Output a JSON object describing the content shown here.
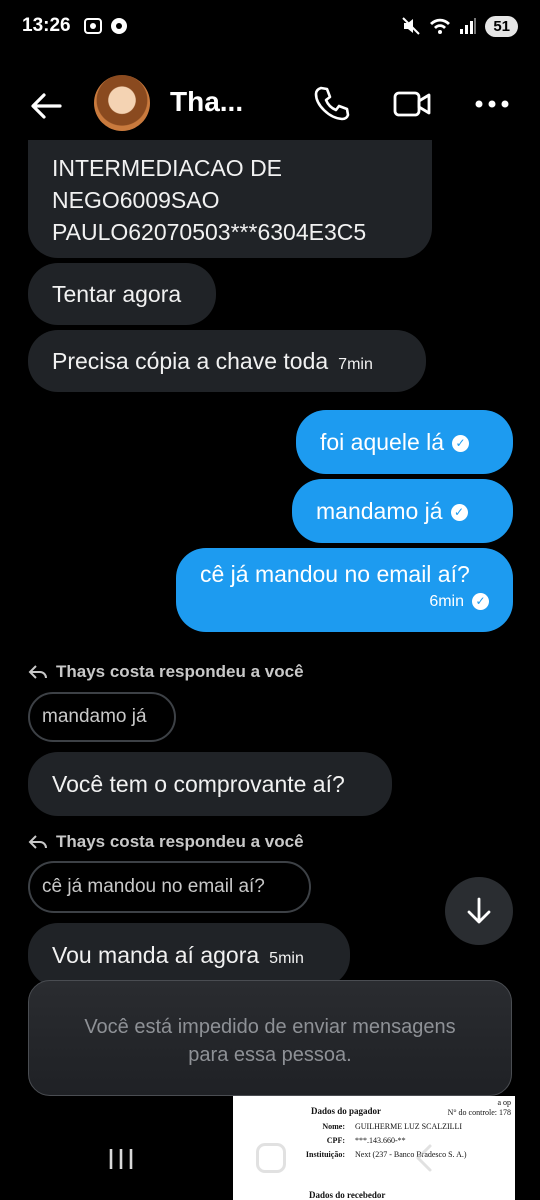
{
  "status_bar": {
    "time": "13:26",
    "battery": "51"
  },
  "header": {
    "contact_name": "Tha..."
  },
  "messages": {
    "m1_line1": "INTERMEDIACAO DE",
    "m1_line2": "NEGO6009SAO",
    "m1_line3": "PAULO62070503***6304E3C5",
    "m2": "Tentar agora",
    "m3": "Precisa cópia a chave toda",
    "m3_time": "7min",
    "m4": "foi aquele lá",
    "m5": "mandamo já",
    "m6": "cê já mandou no email aí?",
    "m6_time": "6min",
    "reply1_label": "Thays costa respondeu a você",
    "reply1_quote": "mandamo já",
    "m7": "Você tem o comprovante aí?",
    "reply2_label": "Thays costa respondeu a você",
    "reply2_quote": "cê já mandou no email aí?",
    "m8": "Vou manda aí agora",
    "m8_time": "5min"
  },
  "blocked_banner": {
    "line1": "Você está impedido de enviar mensagens",
    "line2": "para essa pessoa."
  },
  "document_preview": {
    "top_right_1": "a op",
    "top_right_2": "N° do controle: 178",
    "section_title": "Dados do pagador",
    "name_key": "Nome:",
    "name_val": "GUILHERME LUZ SCALZILLI",
    "cpf_key": "CPF:",
    "cpf_val": "***.143.660-**",
    "inst_key": "Instituição:",
    "inst_val": "Next (237 - Banco Bradesco S. A.)",
    "bottom_title": "Dados do recebedor"
  },
  "colors": {
    "outgoing_bubble": "#1d9bf0",
    "incoming_bubble": "#202327",
    "background": "#000000"
  },
  "icons": {
    "back": "arrow-left-icon",
    "phone": "phone-icon",
    "video": "video-camera-icon",
    "more": "more-dots-icon",
    "reply": "reply-arrow-icon",
    "scroll": "arrow-down-icon",
    "check": "check-circle-icon"
  }
}
